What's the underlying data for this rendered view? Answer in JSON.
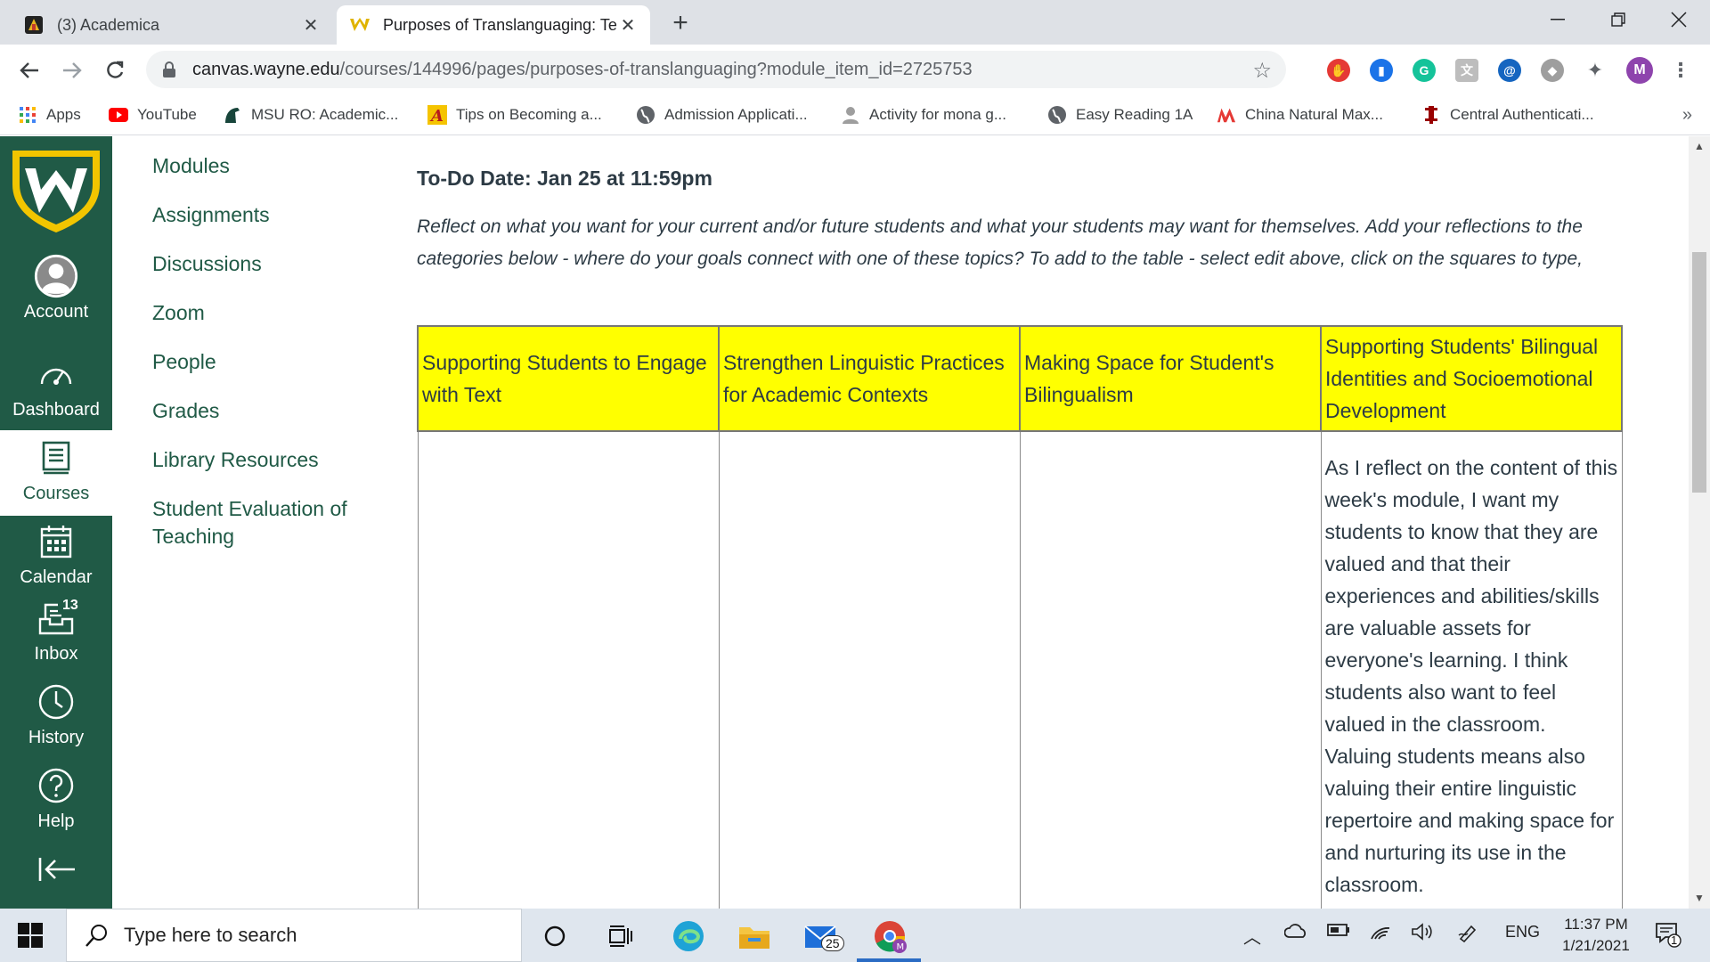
{
  "browser": {
    "tabs": [
      {
        "title": "(3) Academica",
        "active": false
      },
      {
        "title": "Purposes of Translanguaging: Te",
        "active": true
      }
    ],
    "new_tab": "+",
    "url_host": "canvas.wayne.edu",
    "url_path": "/courses/144996/pages/purposes-of-translanguaging?module_item_id=2725753",
    "profile_initial": "M",
    "bookmarks": [
      {
        "label": "Apps",
        "icon": "apps-grid-icon"
      },
      {
        "label": "YouTube",
        "icon": "youtube-icon"
      },
      {
        "label": "MSU RO: Academic...",
        "icon": "spartan-icon"
      },
      {
        "label": "Tips on Becoming a...",
        "icon": "a-logo-icon"
      },
      {
        "label": "Admission Applicati...",
        "icon": "globe-icon"
      },
      {
        "label": "Activity for mona g...",
        "icon": "person-icon"
      },
      {
        "label": "Easy Reading 1A",
        "icon": "globe-icon"
      },
      {
        "label": "China Natural Max...",
        "icon": "m-logo-icon"
      },
      {
        "label": "Central Authenticati...",
        "icon": "iu-logo-icon"
      }
    ],
    "bookmarks_more": "»"
  },
  "global_nav": {
    "items": [
      {
        "label": "Account",
        "icon": "avatar-icon"
      },
      {
        "label": "Dashboard",
        "icon": "dashboard-icon"
      },
      {
        "label": "Courses",
        "icon": "courses-icon",
        "active": true
      },
      {
        "label": "Calendar",
        "icon": "calendar-icon"
      },
      {
        "label": "Inbox",
        "icon": "inbox-icon",
        "badge": "13"
      },
      {
        "label": "History",
        "icon": "clock-icon"
      },
      {
        "label": "Help",
        "icon": "help-icon"
      }
    ]
  },
  "course_nav": {
    "links": [
      "Modules",
      "Assignments",
      "Discussions",
      "Zoom",
      "People",
      "Grades",
      "Library Resources",
      "Student Evaluation of Teaching"
    ]
  },
  "page": {
    "todo": "To-Do Date: Jan 25 at 11:59pm",
    "instructions": "Reflect on what you want for your current and/or future students and what your students may want for themselves.  Add your reflections to the categories below - where do your goals connect with one of these topics? To add to the table - select edit above, click on the squares to type,",
    "table": {
      "headers": [
        "Supporting Students to Engage with Text",
        "Strengthen Linguistic Practices for Academic Contexts",
        "Making Space for Student's Bilingualism",
        "Supporting Students' Bilingual Identities and Socioemotional Development"
      ],
      "row": [
        "",
        "",
        "",
        "As I reflect on the content of this week's module, I want my students to know that they are valued and that their experiences and abilities/skills are valuable assets for everyone's learning.  I think students also want to feel valued in the classroom.  Valuing students means also valuing their entire linguistic repertoire and making space for and nurturing its use in the classroom."
      ]
    }
  },
  "taskbar": {
    "search_placeholder": "Type here to search",
    "mail_badge": "25",
    "language": "ENG",
    "time": "11:37 PM",
    "date": "1/21/2021",
    "notification_count": "1"
  },
  "colors": {
    "canvas_green": "#205a46",
    "header_yellow": "#ffff00",
    "chrome_tabbar": "#dee1e6"
  }
}
